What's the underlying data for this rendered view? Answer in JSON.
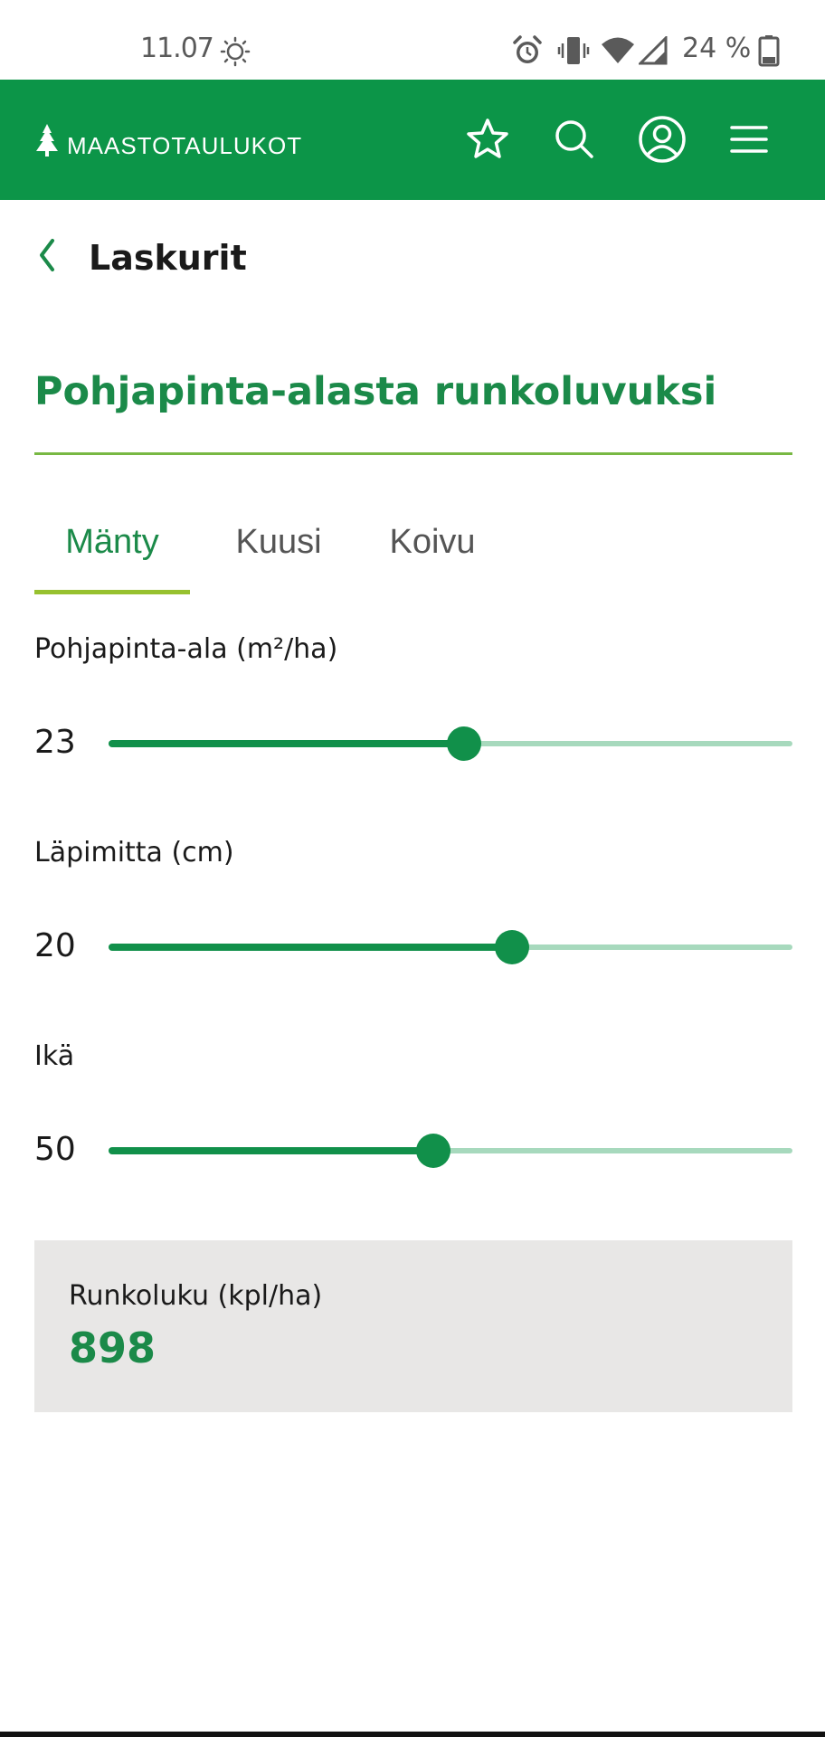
{
  "status_bar": {
    "time": "11.07",
    "battery": "24 %"
  },
  "header": {
    "brand": "MAASTOTAULUKOT",
    "icons": [
      "star-icon",
      "search-icon",
      "account-icon",
      "menu-icon"
    ]
  },
  "nav": {
    "back_label": "Laskurit"
  },
  "page": {
    "title": "Pohjapinta-alasta runkoluvuksi"
  },
  "tabs": [
    {
      "label": "Mänty",
      "active": true
    },
    {
      "label": "Kuusi",
      "active": false
    },
    {
      "label": "Koivu",
      "active": false
    }
  ],
  "fields": [
    {
      "label": "Pohjapinta-ala (m²/ha)",
      "value": "23",
      "fraction": 0.52
    },
    {
      "label": "Läpimitta (cm)",
      "value": "20",
      "fraction": 0.59
    },
    {
      "label": "Ikä",
      "value": "50",
      "fraction": 0.475
    }
  ],
  "result": {
    "label": "Runkoluku (kpl/ha)",
    "value": "898"
  },
  "colors": {
    "primary": "#0c9548",
    "title": "#1b8a49",
    "slider_fill": "#11904a",
    "slider_track": "#a7d9bd",
    "tab_indicator": "#97c12f",
    "result_bg": "#e8e7e6"
  }
}
